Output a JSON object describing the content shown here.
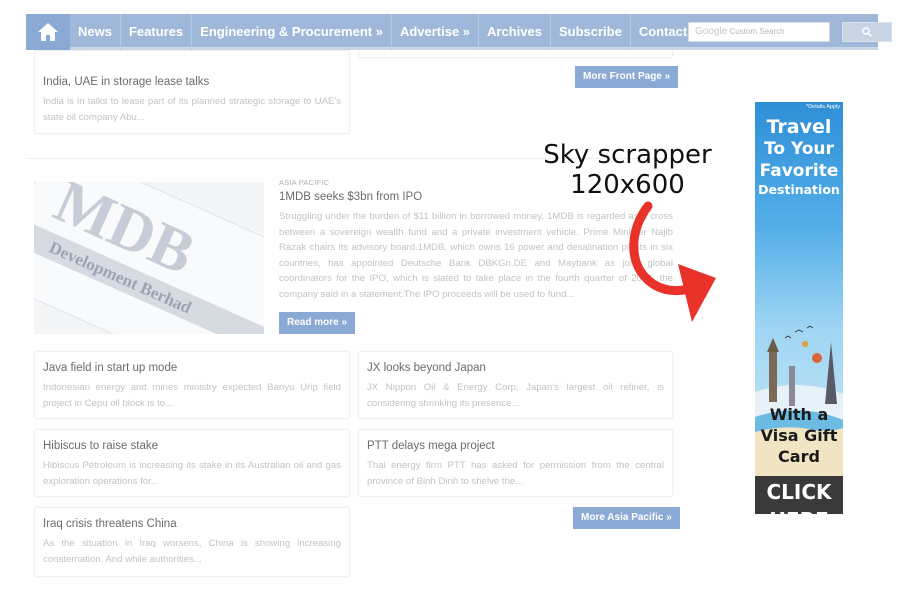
{
  "nav": {
    "home_icon": "home-icon",
    "items": [
      "News",
      "Features",
      "Engineering & Procurement »",
      "Advertise »",
      "Archives",
      "Subscribe",
      "Contact Us"
    ],
    "search_placeholder_brand": "Google",
    "search_placeholder": "Custom Search",
    "search_button_icon": "search-icon"
  },
  "front_story": {
    "title": "India, UAE in storage lease talks",
    "excerpt": "India is in talks to lease part of its planned strategic storage to UAE's state oil company Abu..."
  },
  "more_front_page": "More Front Page »",
  "featured": {
    "category": "ASIA PACIFIC",
    "title": "1MDB seeks $3bn from IPO",
    "body": "Struggling under the burden of $11 billion in borrowed money, 1MDB is regarded as a cross between a sovereign wealth fund and a private investment vehicle. Prime Minister Najib Razak chairs its advisory board.1MDB, which owns 16 power and desalination plants in six countries, has appointed Deutsche Bank DBKGn.DE and Maybank as joint global coordinators for the IPO, which is slated to take place in the fourth quarter of 2014, the company said in a statement.The IPO proceeds will be used to fund...",
    "read_more": "Read more »",
    "image_text_top": "MDB",
    "image_text_bottom": "Development Berhad"
  },
  "stories": [
    {
      "title": "Java field in start up mode",
      "excerpt": " Indonesian energy and mines ministry expected Banyu Urip field project in Cepu oil block is to..."
    },
    {
      "title": "JX looks beyond Japan",
      "excerpt": "JX Nippon Oil & Energy Corp, Japan's largest oil refiner, is considering shrinking its presence..."
    },
    {
      "title": "Hibiscus to raise stake",
      "excerpt": "Hibiscus Petroleum is increasing its stake in its Australian oil and gas exploration operations for..."
    },
    {
      "title": "PTT delays mega project",
      "excerpt": "Thai energy firm PTT has asked for permission from the central province of Binh Dinh to shelve the..."
    },
    {
      "title": "Iraq crisis threatens China",
      "excerpt": "As the situation in Iraq worsens, China is showing increasing consternation. And while authorities..."
    }
  ],
  "more_asia_pacific": "More Asia Pacific »",
  "annotation": {
    "line1": "Sky scrapper",
    "line2": "120x600",
    "accent": "#e8322a"
  },
  "ad": {
    "details": "*Details Apply",
    "line1": "Travel",
    "line2": "To Your",
    "line3": "Favorite",
    "line4": "Destination",
    "visa1": "With a",
    "visa2": "Visa Gift",
    "visa3": "Card",
    "click": "CLICK",
    "here": "HERE"
  },
  "colors": {
    "nav": "#9fb8d9",
    "button": "#8aa9d4"
  }
}
